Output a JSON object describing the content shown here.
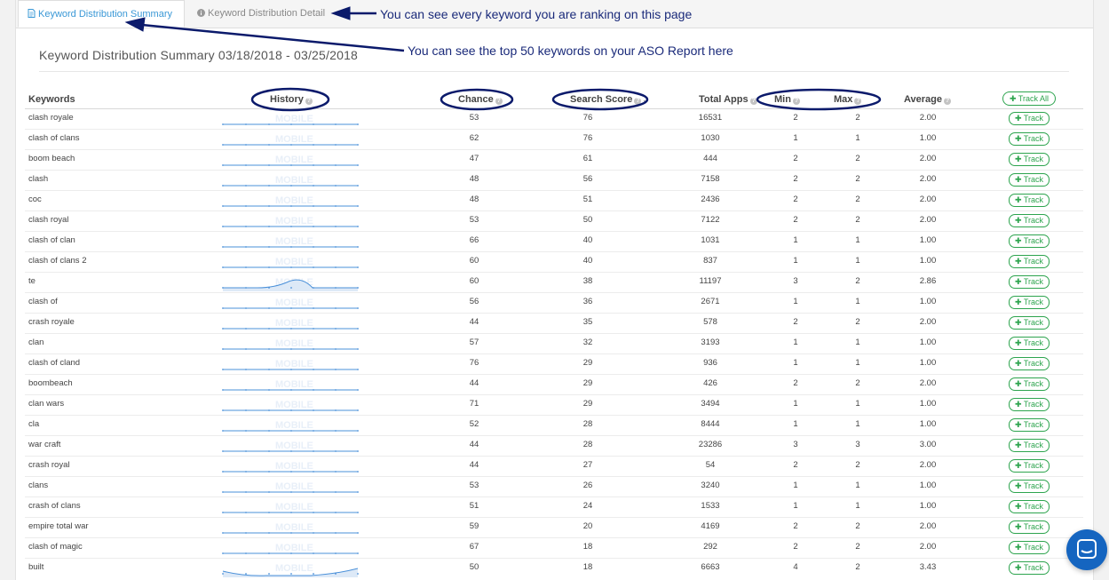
{
  "tabs": {
    "summary": "Keyword Distribution Summary",
    "detail": "Keyword Distribution Detail"
  },
  "annotations": {
    "detail_note": "You can see every keyword you are ranking on this page",
    "summary_note": "You can see the top 50 keywords on your ASO Report here"
  },
  "title": "Keyword Distribution Summary 03/18/2018 - 03/25/2018",
  "columns": {
    "keywords": "Keywords",
    "history": "History",
    "chance": "Chance",
    "search_score": "Search Score",
    "total_apps": "Total Apps",
    "min": "Min",
    "max": "Max",
    "average": "Average",
    "track_all": "Track All"
  },
  "watermark": "MOBILE",
  "track_label": "Track",
  "rows": [
    {
      "keyword": "clash royale",
      "chance": "53",
      "search_score": "76",
      "total_apps": "16531",
      "min": "2",
      "max": "2",
      "average": "2.00"
    },
    {
      "keyword": "clash of clans",
      "chance": "62",
      "search_score": "76",
      "total_apps": "1030",
      "min": "1",
      "max": "1",
      "average": "1.00"
    },
    {
      "keyword": "boom beach",
      "chance": "47",
      "search_score": "61",
      "total_apps": "444",
      "min": "2",
      "max": "2",
      "average": "2.00"
    },
    {
      "keyword": "clash",
      "chance": "48",
      "search_score": "56",
      "total_apps": "7158",
      "min": "2",
      "max": "2",
      "average": "2.00"
    },
    {
      "keyword": "coc",
      "chance": "48",
      "search_score": "51",
      "total_apps": "2436",
      "min": "2",
      "max": "2",
      "average": "2.00"
    },
    {
      "keyword": "clash royal",
      "chance": "53",
      "search_score": "50",
      "total_apps": "7122",
      "min": "2",
      "max": "2",
      "average": "2.00"
    },
    {
      "keyword": "clash of clan",
      "chance": "66",
      "search_score": "40",
      "total_apps": "1031",
      "min": "1",
      "max": "1",
      "average": "1.00"
    },
    {
      "keyword": "clash of clans 2",
      "chance": "60",
      "search_score": "40",
      "total_apps": "837",
      "min": "1",
      "max": "1",
      "average": "1.00"
    },
    {
      "keyword": "te",
      "chance": "60",
      "search_score": "38",
      "total_apps": "11197",
      "min": "3",
      "max": "2",
      "average": "2.86"
    },
    {
      "keyword": "clash of",
      "chance": "56",
      "search_score": "36",
      "total_apps": "2671",
      "min": "1",
      "max": "1",
      "average": "1.00"
    },
    {
      "keyword": "crash royale",
      "chance": "44",
      "search_score": "35",
      "total_apps": "578",
      "min": "2",
      "max": "2",
      "average": "2.00"
    },
    {
      "keyword": "clan",
      "chance": "57",
      "search_score": "32",
      "total_apps": "3193",
      "min": "1",
      "max": "1",
      "average": "1.00"
    },
    {
      "keyword": "clash of cland",
      "chance": "76",
      "search_score": "29",
      "total_apps": "936",
      "min": "1",
      "max": "1",
      "average": "1.00"
    },
    {
      "keyword": "boombeach",
      "chance": "44",
      "search_score": "29",
      "total_apps": "426",
      "min": "2",
      "max": "2",
      "average": "2.00"
    },
    {
      "keyword": "clan wars",
      "chance": "71",
      "search_score": "29",
      "total_apps": "3494",
      "min": "1",
      "max": "1",
      "average": "1.00"
    },
    {
      "keyword": "cla",
      "chance": "52",
      "search_score": "28",
      "total_apps": "8444",
      "min": "1",
      "max": "1",
      "average": "1.00"
    },
    {
      "keyword": "war craft",
      "chance": "44",
      "search_score": "28",
      "total_apps": "23286",
      "min": "3",
      "max": "3",
      "average": "3.00"
    },
    {
      "keyword": "crash royal",
      "chance": "44",
      "search_score": "27",
      "total_apps": "54",
      "min": "2",
      "max": "2",
      "average": "2.00"
    },
    {
      "keyword": "clans",
      "chance": "53",
      "search_score": "26",
      "total_apps": "3240",
      "min": "1",
      "max": "1",
      "average": "1.00"
    },
    {
      "keyword": "crash of clans",
      "chance": "51",
      "search_score": "24",
      "total_apps": "1533",
      "min": "1",
      "max": "1",
      "average": "1.00"
    },
    {
      "keyword": "empire total war",
      "chance": "59",
      "search_score": "20",
      "total_apps": "4169",
      "min": "2",
      "max": "2",
      "average": "2.00"
    },
    {
      "keyword": "clash of magic",
      "chance": "67",
      "search_score": "18",
      "total_apps": "292",
      "min": "2",
      "max": "2",
      "average": "2.00"
    },
    {
      "keyword": "built",
      "chance": "50",
      "search_score": "18",
      "total_apps": "6663",
      "min": "4",
      "max": "2",
      "average": "3.43"
    }
  ],
  "colors": {
    "accent": "#3a98d6",
    "track_green": "#2da44e",
    "annotation_navy": "#1a2a7a",
    "sparkline": "#4a90d9"
  },
  "icons": {
    "summary_tab": "document-icon",
    "detail_tab": "info-icon",
    "track": "plus-icon",
    "chat": "chat-bubble-icon"
  }
}
